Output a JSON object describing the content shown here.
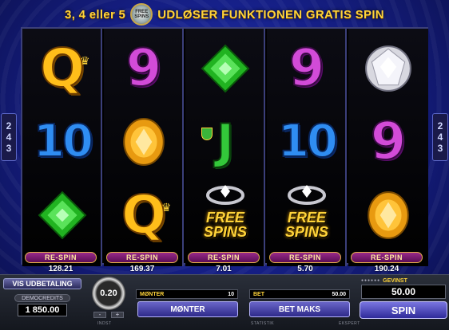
{
  "header": {
    "prefix": "3, 4 eller 5",
    "logo_text": "FREE SPINS",
    "suffix": "UDLØSER FUNKTIONEN GRATIS SPIN"
  },
  "side_marker": {
    "line1": "2",
    "line2": "4",
    "line3": "3"
  },
  "reels": [
    {
      "symbols": [
        "Q",
        "10",
        "emerald"
      ],
      "respin_label": "RE-SPIN",
      "win": "128.21"
    },
    {
      "symbols": [
        "9",
        "topaz",
        "Q"
      ],
      "respin_label": "RE-SPIN",
      "win": "169.37"
    },
    {
      "symbols": [
        "emerald",
        "J",
        "free-spins"
      ],
      "respin_label": "RE-SPIN",
      "win": "7.01"
    },
    {
      "symbols": [
        "9",
        "10",
        "free-spins"
      ],
      "respin_label": "RE-SPIN",
      "win": "5.70"
    },
    {
      "symbols": [
        "diamond",
        "9",
        "topaz"
      ],
      "respin_label": "RE-SPIN",
      "win": "190.24"
    }
  ],
  "symbol_labels": {
    "Q": "Q",
    "10": "10",
    "9": "9",
    "J": "J",
    "free_line1": "FREE",
    "free_line2": "SPINS"
  },
  "bottom": {
    "vis_button": "VIS UDBETALING",
    "credit_label": "DEMOCREDITS",
    "credit_value": "1 850.00",
    "coin_value": "0.20",
    "coin_minus": "-",
    "coin_plus": "+",
    "indst_label": "INDST",
    "statistik_label": "STATISTIK",
    "ekspert_label": "EKSPERT",
    "monter_label": "MØNTER",
    "monter_value": "10",
    "bet_label": "BET",
    "bet_value": "50.00",
    "monter_button": "MØNTER",
    "betmaks_button": "BET MAKS",
    "gevinst_label": "GEVINST",
    "gevinst_value": "50.00",
    "spin_button": "SPIN"
  },
  "colors": {
    "background": "#16208a",
    "header_text": "#ffd43a",
    "respin": "#9a2a8a",
    "button": "#4a46b0"
  }
}
